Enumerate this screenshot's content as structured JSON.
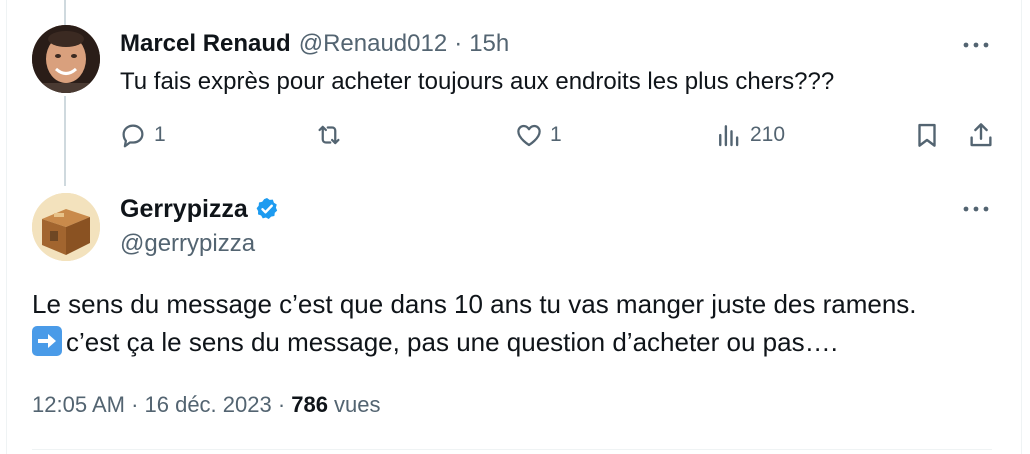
{
  "reply_tweet": {
    "author": {
      "display_name": "Marcel Renaud",
      "handle": "@Renaud012"
    },
    "separator": "·",
    "time_ago": "15h",
    "text": "Tu fais exprès pour acheter toujours aux endroits les plus chers???",
    "stats": {
      "replies": "1",
      "likes": "1",
      "views": "210"
    }
  },
  "main_tweet": {
    "author": {
      "display_name": "Gerrypizza",
      "handle": "@gerrypizza",
      "verified": true
    },
    "text_line1": "Le sens du message c’est que dans 10 ans tu vas manger juste des ramens.",
    "text_line2": "c’est ça le sens du message, pas une question d’acheter ou pas….",
    "timestamp": "12:05 AM · 16 déc. 2023 · ",
    "views_count": "786",
    "views_label": "vues"
  },
  "colors": {
    "text_primary": "#0f1419",
    "text_secondary": "#536471",
    "verified_blue": "#1d9bf0",
    "thread_line": "#cfd9de",
    "divider": "#eff3f4"
  },
  "icons": {
    "reply": "reply-icon",
    "retweet": "retweet-icon",
    "like": "heart-icon",
    "views": "views-chart-icon",
    "bookmark": "bookmark-icon",
    "share": "share-icon",
    "more": "more-dots-icon",
    "verified": "verified-badge-icon",
    "arrow_emoji": "right-arrow-emoji-icon"
  }
}
